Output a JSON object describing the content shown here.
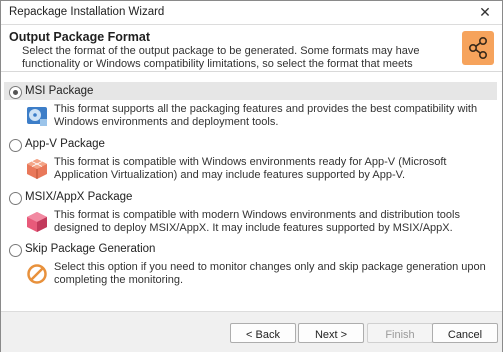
{
  "window": {
    "title": "Repackage Installation Wizard"
  },
  "header": {
    "title": "Output Package Format",
    "description": "Select the format of the output package to be generated. Some formats may have functionality or Windows compatibility limitations, so select the format that meets your requirements."
  },
  "options": [
    {
      "label": "MSI Package",
      "checked": true,
      "icon": "msi-disc-icon",
      "description": "This format supports all the packaging features and provides the best compatibility with Windows environments and deployment tools."
    },
    {
      "label": "App-V Package",
      "checked": false,
      "icon": "appv-cube-icon",
      "description": "This format is compatible with Windows environments ready for App-V (Microsoft Application Virtualization) and may include features supported by App-V."
    },
    {
      "label": "MSIX/AppX Package",
      "checked": false,
      "icon": "msix-box-icon",
      "description": "This format is compatible with modern Windows environments and distribution tools designed to deploy MSIX/AppX. It may include features supported by MSIX/AppX."
    },
    {
      "label": "Skip Package Generation",
      "checked": false,
      "icon": "skip-forbidden-icon",
      "description": "Select this option if you need to monitor changes only and skip package generation upon completing the monitoring."
    }
  ],
  "buttons": {
    "back": "< Back",
    "next": "Next >",
    "finish": "Finish",
    "cancel": "Cancel"
  },
  "colors": {
    "header_icon_bg": "#f6a35c",
    "skip_icon": "#e8913c"
  }
}
